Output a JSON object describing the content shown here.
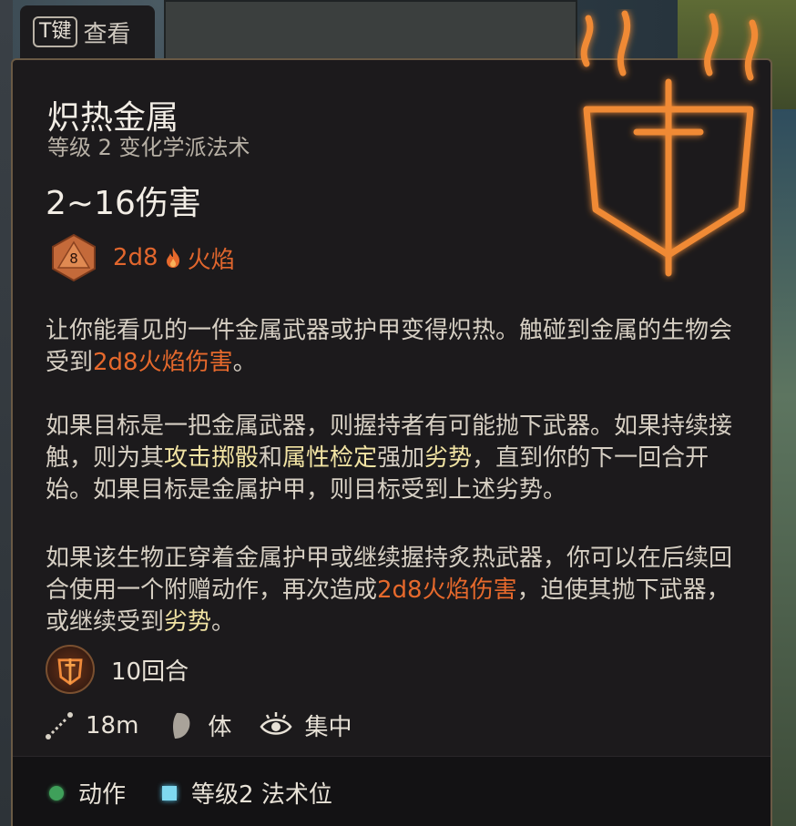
{
  "hotkey": {
    "key": "T键",
    "label": "查看"
  },
  "spell": {
    "name": "炽热金属",
    "subtitle": "等级 2 变化学派法术",
    "damage_range": "2~16伤害",
    "dice_face": "8",
    "dice_notation": "2d8",
    "damage_type": "火焰"
  },
  "description": {
    "p1": [
      "让你能看见的一件金属武器或护甲变得炽热。触碰到金属的生物会受到",
      "2d8火焰伤害",
      "。"
    ],
    "p2": [
      "如果目标是一把金属武器，则握持者有可能抛下武器。如果持续接触，则为其",
      "攻击掷骰",
      "和",
      "属性检定",
      "强加",
      "劣势",
      "，直到你的下一回合开始。如果目标是金属护甲，则目标受到上述劣势。"
    ],
    "p3": [
      "如果该生物正穿着金属护甲或继续握持炙热武器，你可以在后续回合使用一个附赠动作，再次造成",
      "2d8火焰伤害",
      "，迫使其抛下武器，或继续受到",
      "劣势",
      "。"
    ]
  },
  "duration": "10回合",
  "stats": {
    "range": "18m",
    "save": "体",
    "concentration": "集中"
  },
  "footer": {
    "cost_action": "动作",
    "cost_slot": "等级2 法术位"
  },
  "colors": {
    "accent_orange": "#e6692c",
    "keyword_yellow": "#f1e3a3",
    "action_green": "#3fa05a",
    "slot_blue": "#7fd8f0"
  }
}
